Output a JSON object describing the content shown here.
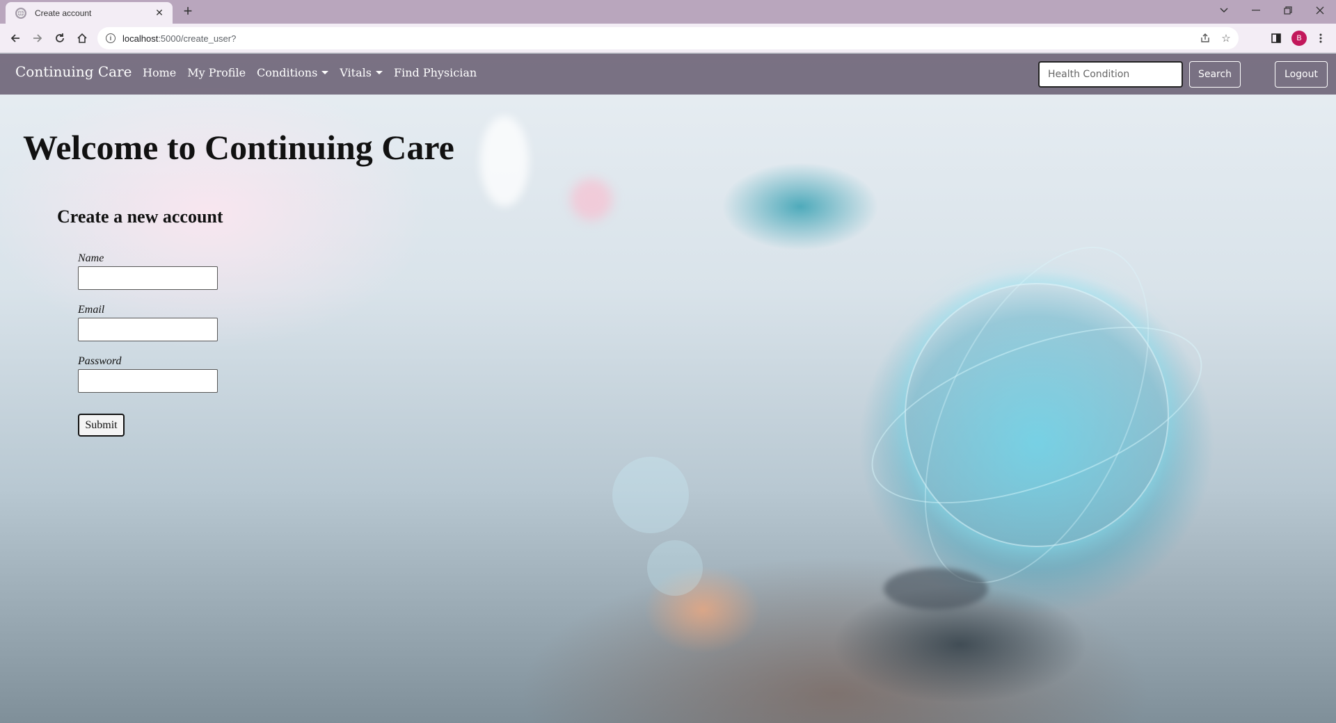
{
  "browser": {
    "tab_title": "Create account",
    "url_host": "localhost",
    "url_rest": ":5000/create_user?",
    "profile_initial": "B"
  },
  "navbar": {
    "brand": "Continuing Care",
    "links": {
      "home": "Home",
      "profile": "My Profile",
      "conditions": "Conditions",
      "vitals": "Vitals",
      "find_physician": "Find Physician"
    },
    "search_placeholder": "Health Condition",
    "search_label": "Search",
    "logout_label": "Logout"
  },
  "main": {
    "welcome": "Welcome to Continuing Care",
    "subheading": "Create a new account",
    "form": {
      "name_label": "Name",
      "email_label": "Email",
      "password_label": "Password",
      "submit_label": "Submit"
    }
  },
  "colors": {
    "tabstrip": "#b9a6bd",
    "navbar": "#70667a",
    "avatar": "#c2185b"
  }
}
